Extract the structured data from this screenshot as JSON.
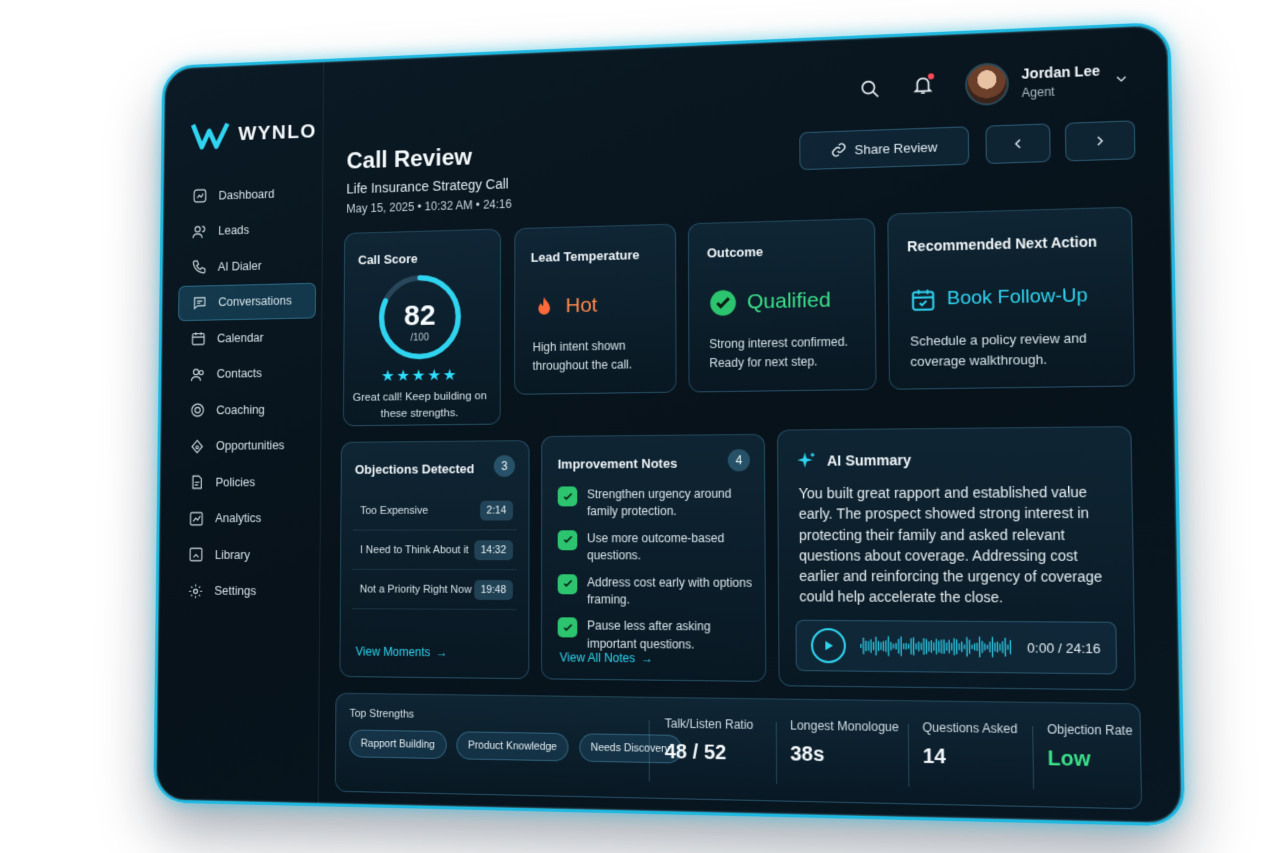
{
  "brand": {
    "name": "WYNLO"
  },
  "sidebar": {
    "items": [
      {
        "label": "Dashboard",
        "icon": "dashboard-icon"
      },
      {
        "label": "Leads",
        "icon": "leads-icon"
      },
      {
        "label": "AI Dialer",
        "icon": "phone-icon"
      },
      {
        "label": "Conversations",
        "icon": "chat-icon",
        "active": true
      },
      {
        "label": "Calendar",
        "icon": "calendar-icon"
      },
      {
        "label": "Contacts",
        "icon": "contacts-icon"
      },
      {
        "label": "Coaching",
        "icon": "target-icon"
      },
      {
        "label": "Opportunities",
        "icon": "opportunities-icon"
      },
      {
        "label": "Policies",
        "icon": "policy-icon"
      },
      {
        "label": "Analytics",
        "icon": "analytics-icon"
      },
      {
        "label": "Library",
        "icon": "library-icon"
      },
      {
        "label": "Settings",
        "icon": "gear-icon"
      }
    ]
  },
  "user": {
    "name": "Jordan Lee",
    "role": "Agent"
  },
  "header": {
    "title": "Call Review",
    "subtitle": "Life Insurance Strategy Call",
    "meta": "May 15, 2025  •  10:32 AM  •  24:16",
    "share_label": "Share Review"
  },
  "call_score": {
    "title": "Call Score",
    "score": "82",
    "out_of": "/100",
    "score_value": 82,
    "stars": "★★★★★",
    "comment": "Great call! Keep building on these strengths."
  },
  "lead_temperature": {
    "title": "Lead Temperature",
    "status": "Hot",
    "text": "High intent shown throughout the call."
  },
  "outcome": {
    "title": "Outcome",
    "status": "Qualified",
    "text": "Strong interest confirmed. Ready for next step."
  },
  "next_action": {
    "title": "Recommended Next Action",
    "action": "Book Follow-Up",
    "text": "Schedule a policy review and coverage walkthrough."
  },
  "objections": {
    "title": "Objections Detected",
    "count": "3",
    "items": [
      {
        "label": "Too Expensive",
        "time": "2:14"
      },
      {
        "label": "I Need to Think About it",
        "time": "14:32"
      },
      {
        "label": "Not a Priority Right Now",
        "time": "19:48"
      }
    ],
    "link": "View Moments"
  },
  "improvement": {
    "title": "Improvement Notes",
    "count": "4",
    "items": [
      "Strengthen urgency around family protection.",
      "Use more outcome-based questions.",
      "Address cost early with options framing.",
      "Pause less after asking important questions."
    ],
    "link": "View All Notes"
  },
  "ai_summary": {
    "title": "AI Summary",
    "text": "You built great rapport and established value early. The prospect showed strong interest in protecting their family and asked relevant questions about coverage. Addressing cost earlier and reinforcing the urgency of coverage could help accelerate the close.",
    "time": "0:00 / 24:16"
  },
  "strengths": {
    "title": "Top Strengths",
    "chips": [
      "Rapport Building",
      "Product Knowledge",
      "Needs Discovery"
    ]
  },
  "stats": [
    {
      "label": "Talk/Listen Ratio",
      "value": "48 / 52"
    },
    {
      "label": "Longest Monologue",
      "value": "38s"
    },
    {
      "label": "Questions Asked",
      "value": "14"
    },
    {
      "label": "Objection Rate",
      "value": "Low",
      "color": "#3ce08a"
    }
  ]
}
